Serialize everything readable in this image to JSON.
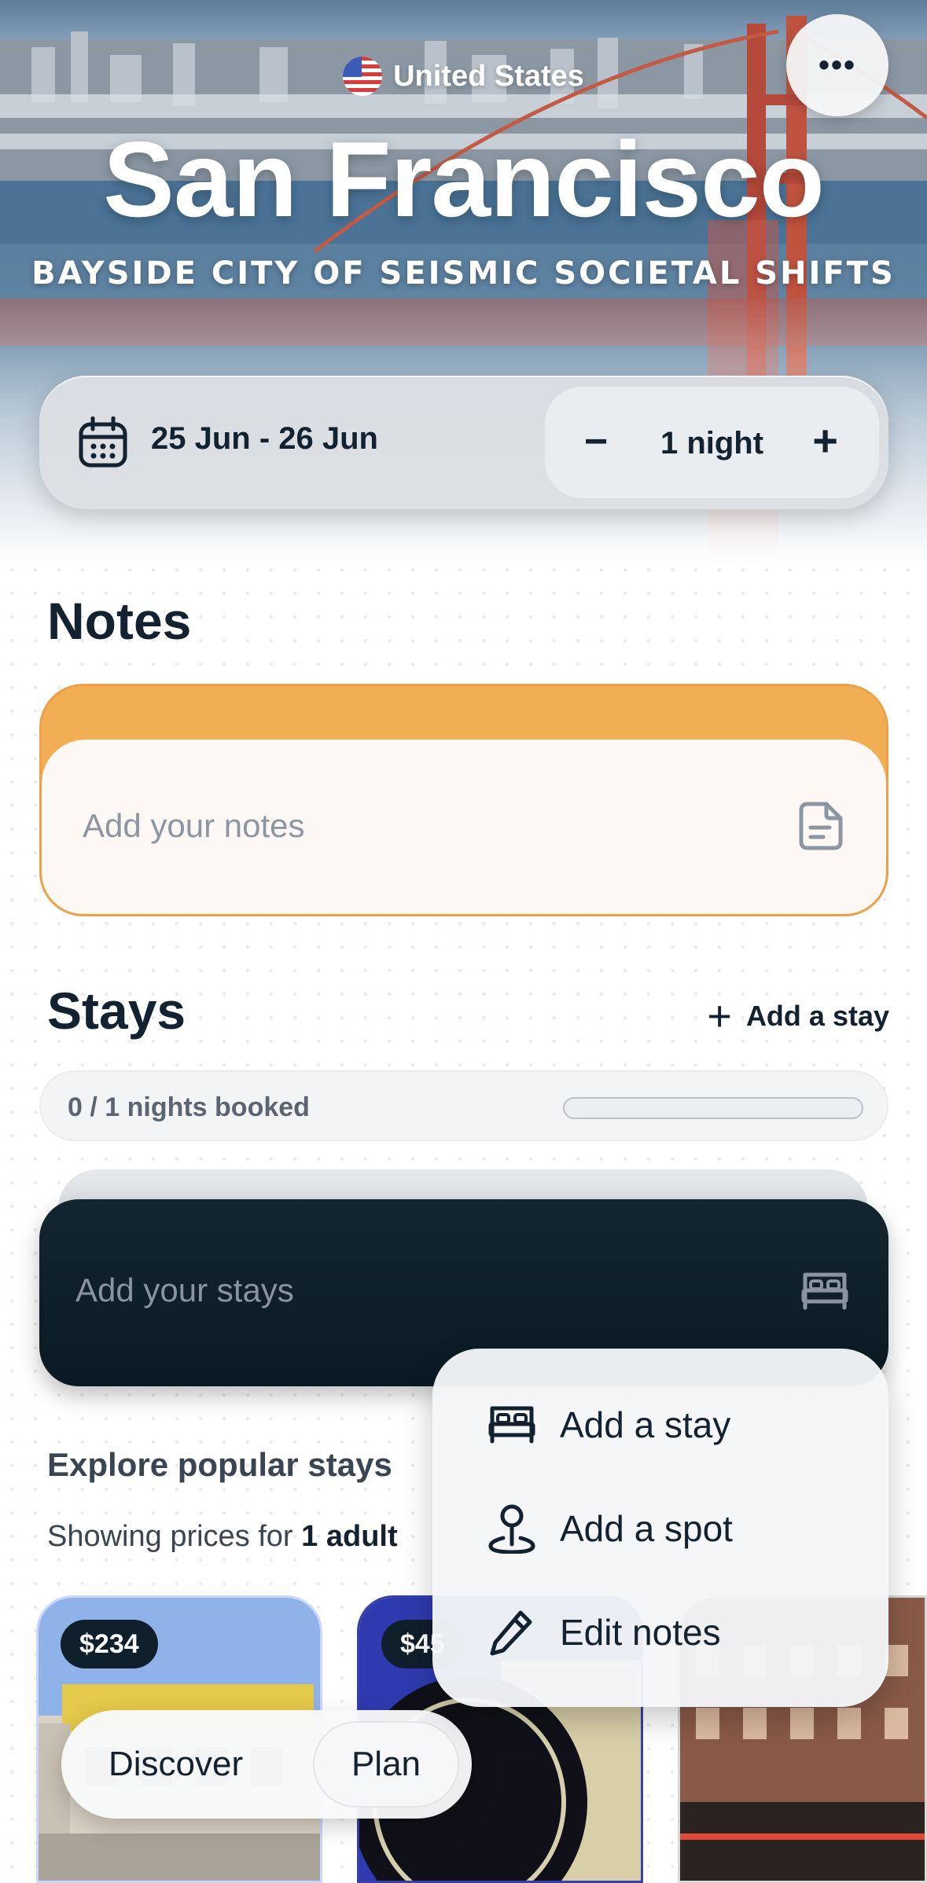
{
  "header": {
    "country": "United States",
    "city": "San Francisco",
    "tagline": "BAYSIDE CITY OF SEISMIC SOCIETAL SHIFTS",
    "more_icon": "more-horizontal-icon"
  },
  "dates": {
    "range": "25 Jun - 26 Jun",
    "nights": "1 night",
    "decrement": "−",
    "increment": "+"
  },
  "notes": {
    "title": "Notes",
    "placeholder": "Add your notes"
  },
  "stays": {
    "title": "Stays",
    "add_label": "Add a stay",
    "booked_text": "0 / 1 nights booked",
    "booked_fraction": 0,
    "placeholder": "Add your stays"
  },
  "explore": {
    "title": "Explore popular stays",
    "subtitle_prefix": "Showing prices for ",
    "subtitle_bold": "1 adult",
    "hotels": [
      {
        "price": "$234"
      },
      {
        "price": "$45"
      },
      {
        "price": ""
      }
    ]
  },
  "nav": {
    "discover": "Discover",
    "plan": "Plan"
  },
  "menu": {
    "items": [
      {
        "label": "Add a stay",
        "icon": "bed-icon"
      },
      {
        "label": "Add a spot",
        "icon": "pin-icon"
      },
      {
        "label": "Edit notes",
        "icon": "pencil-icon"
      }
    ]
  },
  "colors": {
    "notes_accent": "#f2ae52",
    "dark": "#132231"
  }
}
